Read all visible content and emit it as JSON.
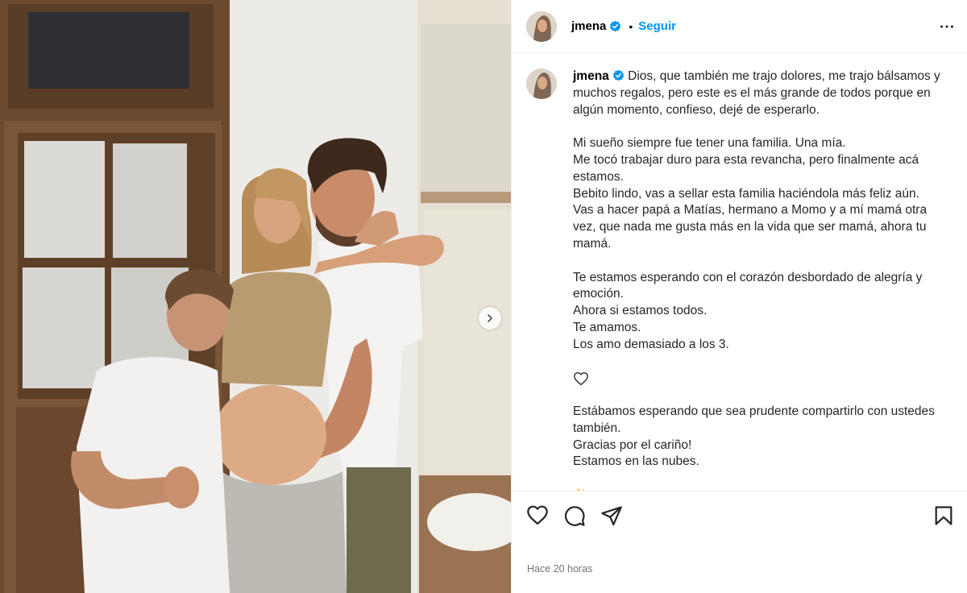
{
  "header": {
    "username": "jmena",
    "follow_label": "Seguir",
    "separator": "•"
  },
  "caption": {
    "username": "jmena",
    "paragraphs": [
      "Dios, que también me trajo dolores, me trajo bálsamos y muchos regalos, pero este es el más grande de todos porque en algún momento, confieso, dejé de esperarlo.",
      "Mi sueño siempre fue tener una familia. Una mía.\nMe tocó trabajar duro para esta revancha, pero finalmente acá estamos.\nBebito lindo, vas a sellar esta familia haciéndola más feliz aún.\nVas a hacer papá a Matías, hermano a Momo y a mí mamá otra vez, que nada me gusta más en la vida que ser mamá, ahora tu mamá.",
      "Te estamos esperando con el corazón desbordado de alegría y emoción.\nAhora si estamos todos.\nTe amamos.\nLos amo demasiado a los 3.",
      "Estábamos esperando que sea prudente compartirlo con ustedes también.\nGracias por el cariño!\nEstamos en las nubes."
    ],
    "trailing": "✨"
  },
  "footer": {
    "timestamp": "Hace 20 horas"
  },
  "icons": {
    "verified": "verified-badge-icon",
    "more": "more-options-icon",
    "like": "heart-icon",
    "comment": "comment-icon",
    "share": "send-icon",
    "save": "bookmark-icon",
    "next": "chevron-right-icon"
  },
  "colors": {
    "link": "#0095f6",
    "verified": "#0095f6",
    "timestamp": "#737373",
    "divider": "#efefef"
  }
}
